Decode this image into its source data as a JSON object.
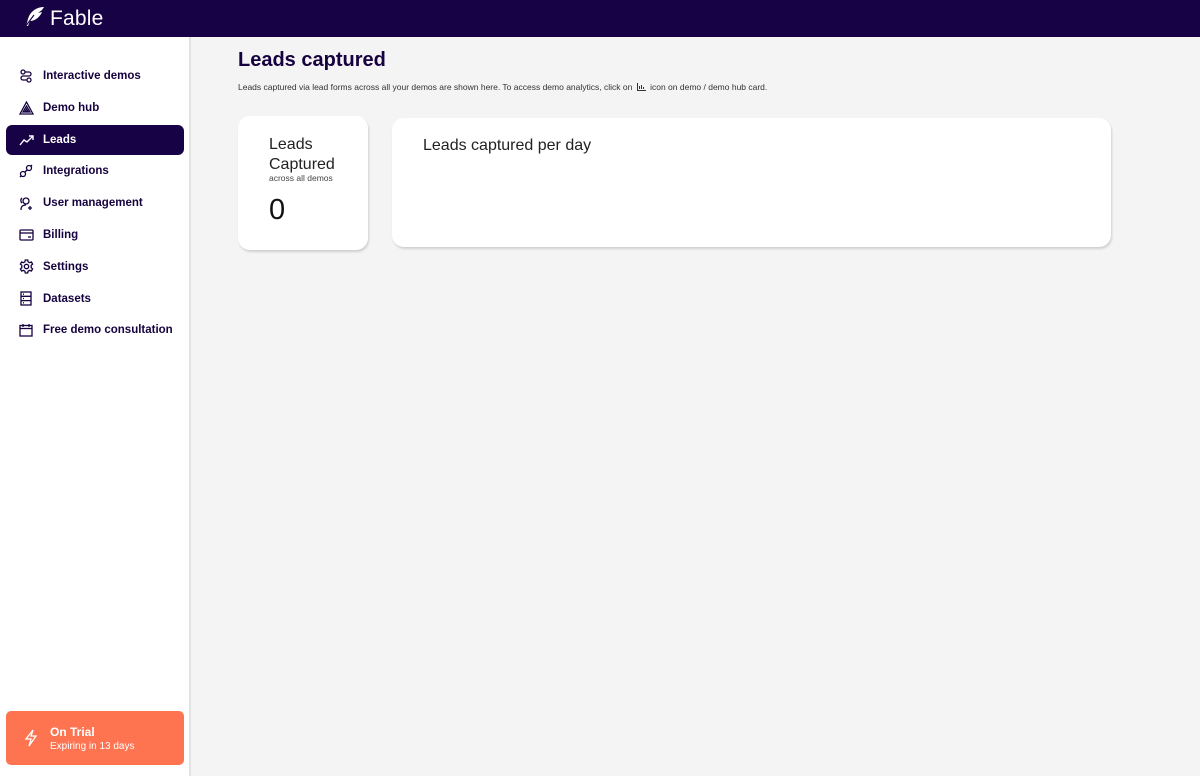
{
  "app": {
    "brand_name": "Fable"
  },
  "sidebar": {
    "items": [
      {
        "label": "Interactive demos",
        "icon": "demos-icon",
        "active": false
      },
      {
        "label": "Demo hub",
        "icon": "demo-hub-icon",
        "active": false
      },
      {
        "label": "Leads",
        "icon": "trend-line-icon",
        "active": true
      },
      {
        "label": "Integrations",
        "icon": "plug-icon",
        "active": false
      },
      {
        "label": "User management",
        "icon": "user-add-icon",
        "active": false
      },
      {
        "label": "Billing",
        "icon": "card-icon",
        "active": false
      },
      {
        "label": "Settings",
        "icon": "gear-icon",
        "active": false
      },
      {
        "label": "Datasets",
        "icon": "database-icon",
        "active": false
      },
      {
        "label": "Free demo consultation",
        "icon": "calendar-icon",
        "active": false
      }
    ],
    "trial": {
      "title": "On Trial",
      "subtitle": "Expiring in 13 days",
      "icon": "lightning-icon"
    }
  },
  "main": {
    "title": "Leads captured",
    "description_before": "Leads captured via lead forms across all your demos are shown here. To access demo analytics, click on",
    "description_icon": "bar-chart-icon",
    "description_after": "icon on demo / demo hub card.",
    "stat_card": {
      "title_line1": "Leads",
      "title_line2": "Captured",
      "subtitle": "across all demos",
      "value": "0"
    },
    "chart_card": {
      "title": "Leads captured per day"
    }
  },
  "colors": {
    "brand_dark": "#160245",
    "trial_accent": "#ff7450",
    "background": "#f4f4f4"
  }
}
